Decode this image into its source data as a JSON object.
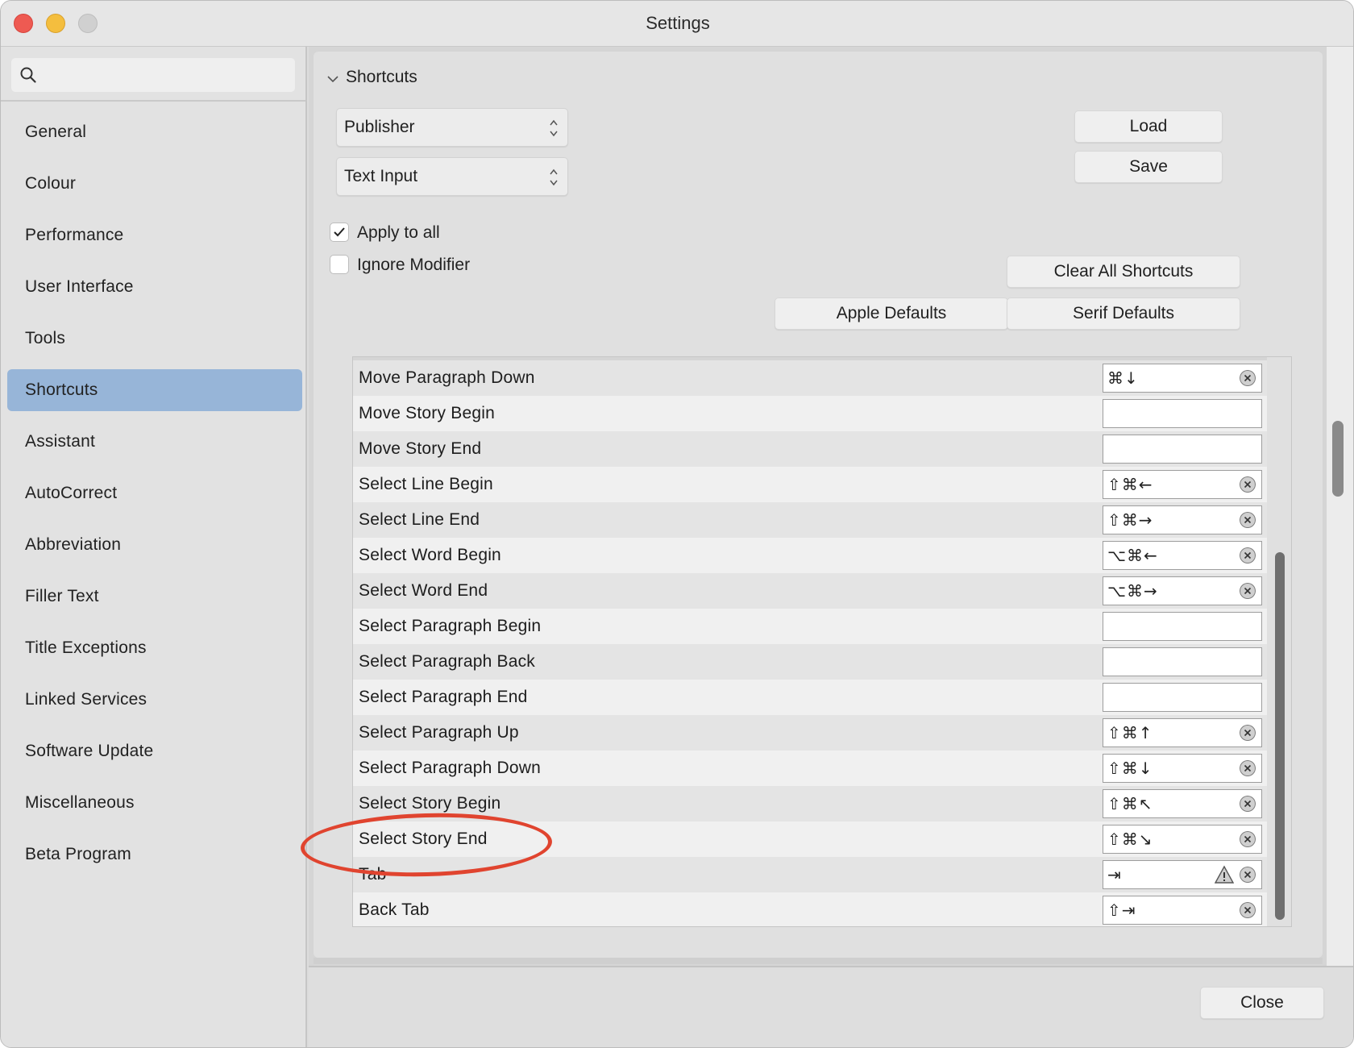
{
  "window": {
    "title": "Settings"
  },
  "sidebar": {
    "search_placeholder": "",
    "items": [
      {
        "label": "General",
        "active": false
      },
      {
        "label": "Colour",
        "active": false
      },
      {
        "label": "Performance",
        "active": false
      },
      {
        "label": "User Interface",
        "active": false
      },
      {
        "label": "Tools",
        "active": false
      },
      {
        "label": "Shortcuts",
        "active": true
      },
      {
        "label": "Assistant",
        "active": false
      },
      {
        "label": "AutoCorrect",
        "active": false
      },
      {
        "label": "Abbreviation",
        "active": false
      },
      {
        "label": "Filler Text",
        "active": false
      },
      {
        "label": "Title Exceptions",
        "active": false
      },
      {
        "label": "Linked Services",
        "active": false
      },
      {
        "label": "Software Update",
        "active": false
      },
      {
        "label": "Miscellaneous",
        "active": false
      },
      {
        "label": "Beta Program",
        "active": false
      }
    ]
  },
  "main": {
    "section_title": "Shortcuts",
    "app_select": "Publisher",
    "category_select": "Text Input",
    "load_label": "Load",
    "save_label": "Save",
    "apply_to_all": {
      "label": "Apply to all",
      "checked": true
    },
    "ignore_modifier": {
      "label": "Ignore Modifier",
      "checked": false
    },
    "clear_all_label": "Clear All Shortcuts",
    "apple_defaults_label": "Apple Defaults",
    "serif_defaults_label": "Serif Defaults",
    "shortcuts": [
      {
        "name": "Move Paragraph Down",
        "keys": "⌘↓",
        "clearable": true,
        "warning": false
      },
      {
        "name": "Move Story Begin",
        "keys": "",
        "clearable": false,
        "warning": false
      },
      {
        "name": "Move Story End",
        "keys": "",
        "clearable": false,
        "warning": false
      },
      {
        "name": "Select Line Begin",
        "keys": "⇧⌘←",
        "clearable": true,
        "warning": false
      },
      {
        "name": "Select Line End",
        "keys": "⇧⌘→",
        "clearable": true,
        "warning": false
      },
      {
        "name": "Select Word Begin",
        "keys": "⌥⌘←",
        "clearable": true,
        "warning": false
      },
      {
        "name": "Select Word End",
        "keys": "⌥⌘→",
        "clearable": true,
        "warning": false
      },
      {
        "name": "Select Paragraph Begin",
        "keys": "",
        "clearable": false,
        "warning": false
      },
      {
        "name": "Select Paragraph Back",
        "keys": "",
        "clearable": false,
        "warning": false
      },
      {
        "name": "Select Paragraph End",
        "keys": "",
        "clearable": false,
        "warning": false
      },
      {
        "name": "Select Paragraph Up",
        "keys": "⇧⌘↑",
        "clearable": true,
        "warning": false
      },
      {
        "name": "Select Paragraph Down",
        "keys": "⇧⌘↓",
        "clearable": true,
        "warning": false
      },
      {
        "name": "Select Story Begin",
        "keys": "⇧⌘↖",
        "clearable": true,
        "warning": false
      },
      {
        "name": "Select Story End",
        "keys": "⇧⌘↘",
        "clearable": true,
        "warning": false
      },
      {
        "name": "Tab",
        "keys": "⇥",
        "clearable": true,
        "warning": true
      },
      {
        "name": "Back Tab",
        "keys": "⇧⇥",
        "clearable": true,
        "warning": false
      }
    ],
    "highlighted_row": "Select Story End",
    "highlight_color": "#e0442f"
  },
  "footer": {
    "close_label": "Close"
  },
  "colors": {
    "selection": "#97b5d8",
    "sidebar_bg": "#e2e2e2"
  }
}
